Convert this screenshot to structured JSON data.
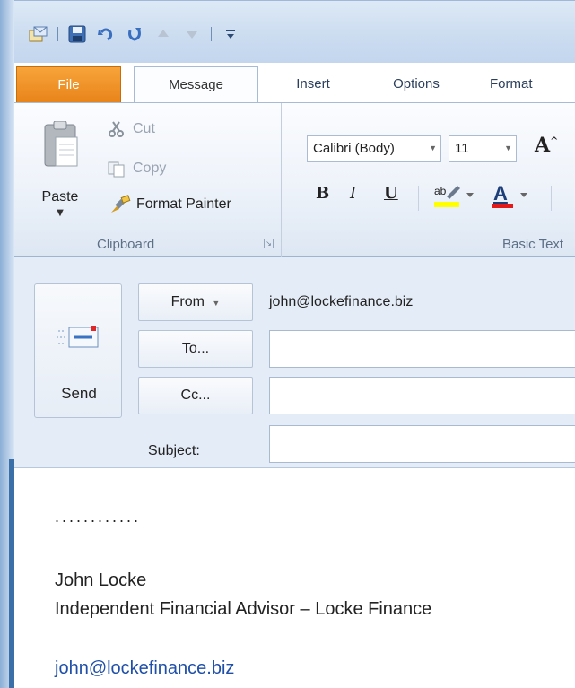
{
  "ribbon_tabs": {
    "file": "File",
    "message": "Message",
    "insert": "Insert",
    "options": "Options",
    "format": "Format"
  },
  "clipboard": {
    "paste": "Paste",
    "cut": "Cut",
    "copy": "Copy",
    "format_painter": "Format Painter",
    "group_label": "Clipboard"
  },
  "basic_text": {
    "font_name": "Calibri (Body)",
    "font_size": "11",
    "bold": "B",
    "italic": "I",
    "underline": "U",
    "group_label": "Basic Text"
  },
  "compose": {
    "send_label": "Send",
    "from_button": "From",
    "from_value": "john@lockefinance.biz",
    "to_button": "To...",
    "cc_button": "Cc...",
    "subject_label": "Subject:",
    "to_value": "",
    "cc_value": "",
    "subject_value": ""
  },
  "body": {
    "dots": "............",
    "name": "John Locke",
    "title": "Independent Financial Advisor – Locke Finance",
    "email": "john@lockefinance.biz"
  },
  "colors": {
    "file_tab": "#e8841a",
    "link": "#1f4fa8",
    "frame": "#3a6fa7"
  }
}
